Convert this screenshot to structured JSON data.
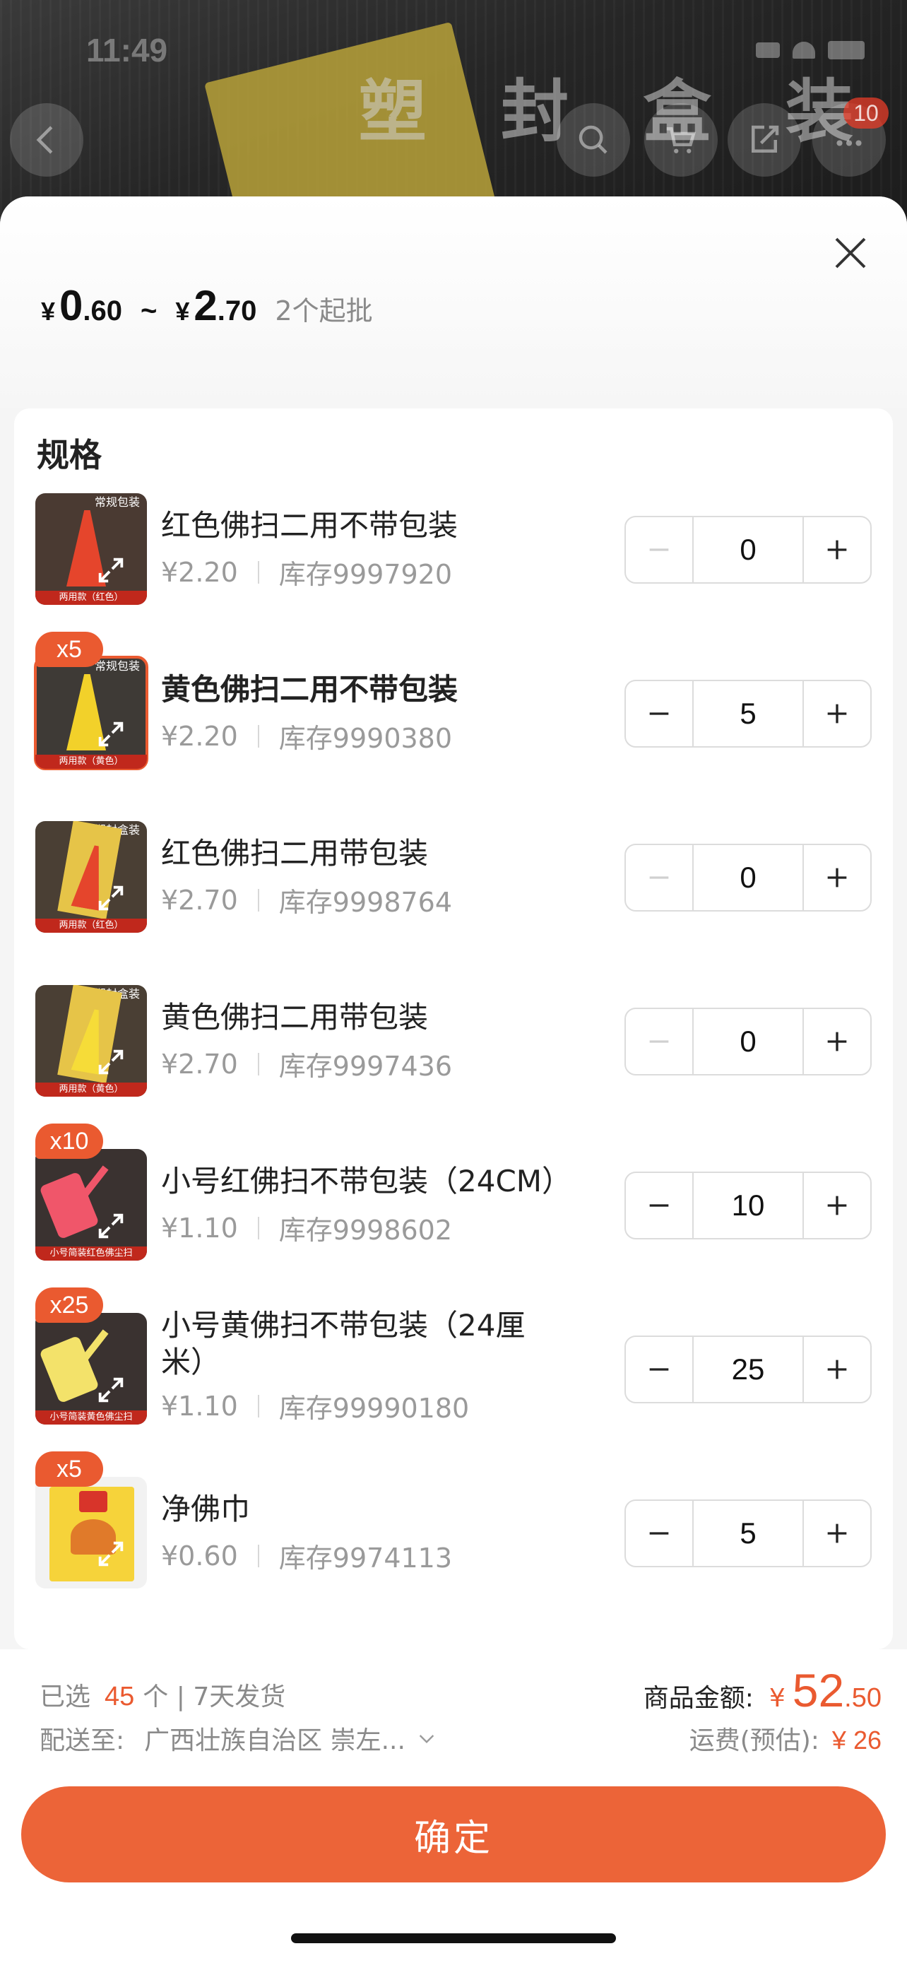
{
  "status_bar": {
    "time": "11:49"
  },
  "backdrop": {
    "banner_text": "塑 封 盒 装",
    "cart_count": "10"
  },
  "price_header": {
    "currency": "¥",
    "min_int": "0",
    "min_dec": ".60",
    "tilde": "~",
    "max_int": "2",
    "max_dec": ".70",
    "moq": "2个起批"
  },
  "spec_title": "规格",
  "skus": [
    {
      "name": "红色佛扫二用不带包装",
      "price": "¥2.20",
      "stock": "库存9997920",
      "qty": "0",
      "badge": "",
      "thumb_tag": "常规包装",
      "thumb_foot": "两用款（红色）"
    },
    {
      "name": "黄色佛扫二用不带包装",
      "price": "¥2.20",
      "stock": "库存9990380",
      "qty": "5",
      "badge": "x5",
      "thumb_tag": "常规包装",
      "thumb_foot": "两用款（黄色）"
    },
    {
      "name": "红色佛扫二用带包装",
      "price": "¥2.70",
      "stock": "库存9998764",
      "qty": "0",
      "badge": "",
      "thumb_tag": "塑封盒装",
      "thumb_foot": "两用款（红色）"
    },
    {
      "name": "黄色佛扫二用带包装",
      "price": "¥2.70",
      "stock": "库存9997436",
      "qty": "0",
      "badge": "",
      "thumb_tag": "塑封盒装",
      "thumb_foot": "两用款（黄色）"
    },
    {
      "name": "小号红佛扫不带包装（24CM）",
      "price": "¥1.10",
      "stock": "库存9998602",
      "qty": "10",
      "badge": "x10",
      "thumb_tag": "",
      "thumb_foot": "小号简装红色佛尘扫"
    },
    {
      "name": "小号黄佛扫不带包装（24厘米）",
      "price": "¥1.10",
      "stock": "库存99990180",
      "qty": "25",
      "badge": "x25",
      "thumb_tag": "",
      "thumb_foot": "小号简装黄色佛尘扫"
    },
    {
      "name": "净佛巾",
      "price": "¥0.60",
      "stock": "库存9974113",
      "qty": "5",
      "badge": "x5",
      "thumb_tag": "",
      "thumb_foot": ""
    }
  ],
  "summary": {
    "selected_prefix": "已选",
    "selected_count": "45",
    "selected_suffix": "个 | 7天发货",
    "ship_to_label": "配送至:",
    "ship_to_address": "广西壮族自治区 崇左...",
    "amount_label": "商品金额:",
    "amount_currency": "¥",
    "amount_int": "52",
    "amount_dec": ".50",
    "shipping_label": "运费(预估):",
    "shipping_value": "¥ 26"
  },
  "confirm_label": "确定",
  "colors": {
    "accent": "#ea5a30",
    "confirm_bg": "#ec6438"
  }
}
